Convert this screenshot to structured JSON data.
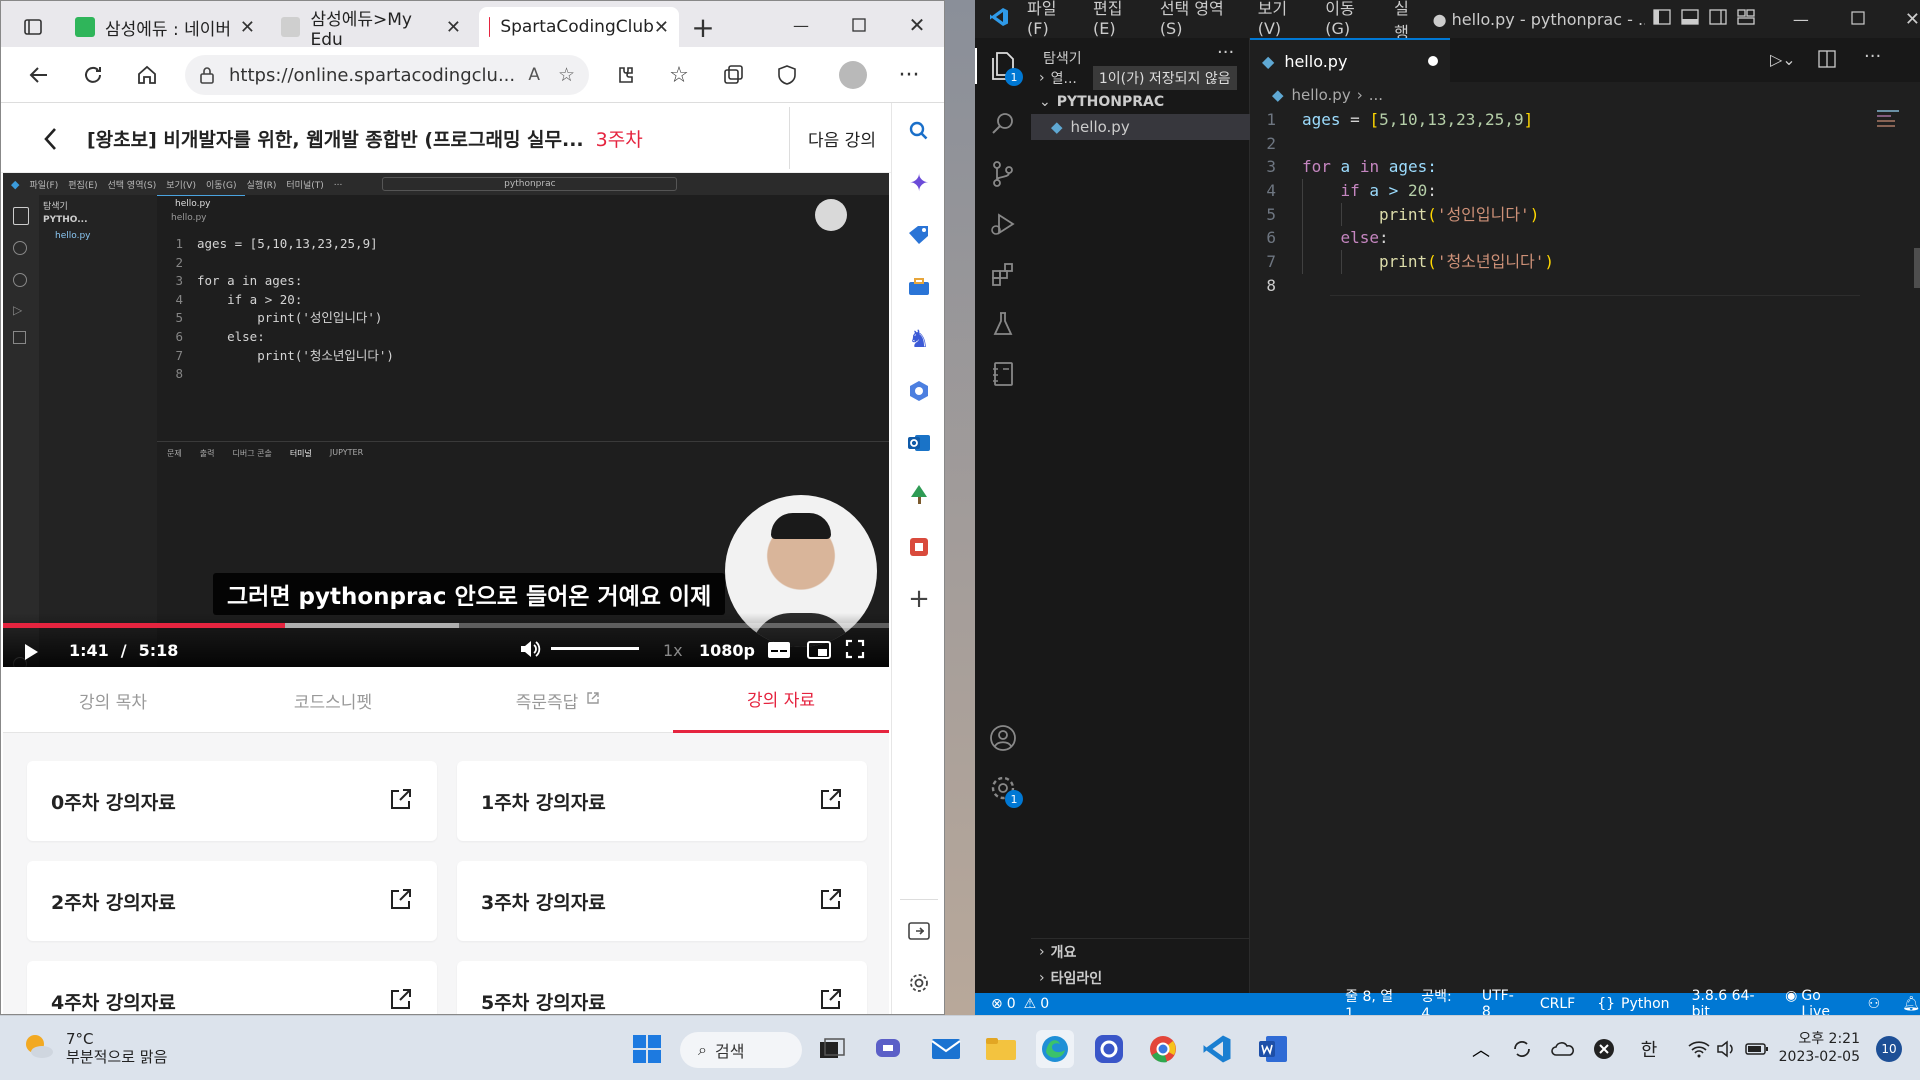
{
  "edge": {
    "tabs": [
      {
        "label": "삼성에듀 : 네이버 ",
        "favicon_color": "#2fb55a",
        "favicon_letter": "N"
      },
      {
        "label": "삼성에듀>My Edu",
        "favicon_color": "#bbbbbb",
        "favicon_letter": "Edu"
      },
      {
        "label": "SpartaCodingClub",
        "favicon_color": "#e5243f",
        "favicon_letter": "S"
      }
    ],
    "url": "https://online.spartacodingclu...",
    "page": {
      "course_title": "[왕초보] 비개발자를 위한, 웹개발 종합반 (프로그래밍 실무...",
      "week": "3주차",
      "next_lecture": "다음 강의"
    },
    "video": {
      "subtitle": "그러면 pythonprac 안으로 들어온 거예요 이제",
      "current_time": "1:41",
      "separator": "/",
      "duration": "5:18",
      "progress_fraction": 0.318,
      "buffered_fraction": 0.515,
      "speed": "1x",
      "quality": "1080p",
      "inner_menu": [
        "파일(F)",
        "편집(E)",
        "선택 영역(S)",
        "보기(V)",
        "이동(G)",
        "실행(R)",
        "터미널(T)",
        "..."
      ],
      "inner_search": "pythonprac",
      "inner_side_header": "탐색기",
      "inner_folder": "PYTHO...",
      "inner_file": "hello.py",
      "inner_tab": "hello.py",
      "inner_crumb": "hello.py",
      "inner_panel_tabs": [
        "문제",
        "출력",
        "디버그 콘솔",
        "터미널",
        "JUPYTER"
      ],
      "inner_code": [
        {
          "n": "1",
          "t": "ages = [5,10,13,23,25,9]"
        },
        {
          "n": "2",
          "t": ""
        },
        {
          "n": "3",
          "t": "for a in ages:"
        },
        {
          "n": "4",
          "t": "    if a > 20:"
        },
        {
          "n": "5",
          "t": "        print('성인입니다')"
        },
        {
          "n": "6",
          "t": "    else:"
        },
        {
          "n": "7",
          "t": "        print('청소년입니다')"
        },
        {
          "n": "8",
          "t": ""
        }
      ]
    },
    "lecture_tabs": [
      "강의 목차",
      "코드스니펫",
      "즉문즉답",
      "강의 자료"
    ],
    "active_lecture_tab": 3,
    "materials": [
      "0주차 강의자료",
      "1주차 강의자료",
      "2주차 강의자료",
      "3주차 강의자료",
      "4주차 강의자료",
      "5주차 강의자료"
    ],
    "brand_color": "#e5243f"
  },
  "vscode": {
    "menu": [
      "파일(F)",
      "편집(E)",
      "선택 영역(S)",
      "보기(V)",
      "이동(G)",
      "실행"
    ],
    "window_title": "● hello.py - pythonprac - ...",
    "explorer_title": "탐색기",
    "open_editors": "열...",
    "unsaved_badge": "1이(가) 저장되지 않음",
    "folder": "PYTHONPRAC",
    "file": "hello.py",
    "outline": "개요",
    "timeline": "타임라인",
    "tab": "hello.py",
    "breadcrumb": [
      "hello.py",
      "..."
    ],
    "explorer_badge": "1",
    "settings_badge": "1",
    "code": [
      {
        "n": "1"
      },
      {
        "n": "2"
      },
      {
        "n": "3"
      },
      {
        "n": "4"
      },
      {
        "n": "5"
      },
      {
        "n": "6"
      },
      {
        "n": "7"
      },
      {
        "n": "8"
      }
    ],
    "code_tokens": {
      "l1": [
        "ages",
        " = ",
        "[",
        "5,10,13,23,25,9",
        "]"
      ],
      "l3": [
        "for",
        " a ",
        "in",
        " ages:"
      ],
      "l4": [
        "if",
        " a > ",
        "20",
        ":"
      ],
      "l5": [
        "print",
        "(",
        "'성인입니다'",
        ")"
      ],
      "l6": [
        "else",
        ":"
      ],
      "l7": [
        "print",
        "(",
        "'청소년입니다'",
        ")"
      ]
    },
    "status": {
      "errors": "0",
      "warnings": "0",
      "position": "줄 8, 열 1",
      "spaces": "공백: 4",
      "encoding": "UTF-8",
      "eol": "CRLF",
      "language": "Python",
      "interpreter": "3.8.6 64-bit",
      "golive": "Go Live"
    },
    "status_color": "#0078d4"
  },
  "taskbar": {
    "weather_temp": "7°C",
    "weather_desc": "부분적으로 맑음",
    "search_label": "검색",
    "ime": "한",
    "time": "오후 2:21",
    "date": "2023-02-05",
    "notifications": "10"
  }
}
